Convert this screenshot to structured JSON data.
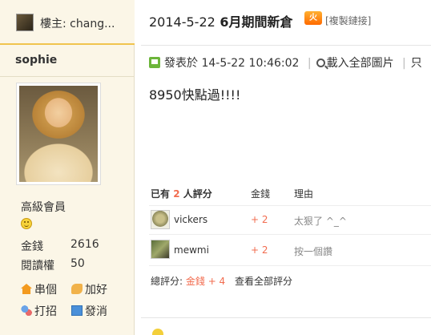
{
  "sidebar": {
    "op_label": "樓主: chang...",
    "username": "sophie",
    "rank": "高級會員",
    "stats": [
      {
        "label": "金錢",
        "value": "2616"
      },
      {
        "label": "閱讀權",
        "value": "50"
      }
    ],
    "actions": {
      "visit": "串個",
      "add_friend": "加好",
      "greet": "打招",
      "message": "發消"
    }
  },
  "post": {
    "title_date": "2014-5-22",
    "title_text": "6月期間新倉",
    "hot_badge": "火",
    "copy_link": "[複製鏈接]",
    "posted_at_label": "發表於",
    "posted_at": "14-5-22 10:46:02",
    "load_images": "載入全部圖片",
    "only_author": "只",
    "body": "8950快點過!!!!"
  },
  "rating": {
    "header_prefix": "已有",
    "header_count": "2",
    "header_suffix": "人評分",
    "col_money": "金錢",
    "col_reason": "理由",
    "rows": [
      {
        "name": "vickers",
        "amount": "+ 2",
        "reason": "太狠了 ^_^"
      },
      {
        "name": "mewmi",
        "amount": "+ 2",
        "reason": "按一個讚"
      }
    ],
    "summary_label": "總評分:",
    "summary_value": "金錢 + 4",
    "view_all": "查看全部評分"
  }
}
